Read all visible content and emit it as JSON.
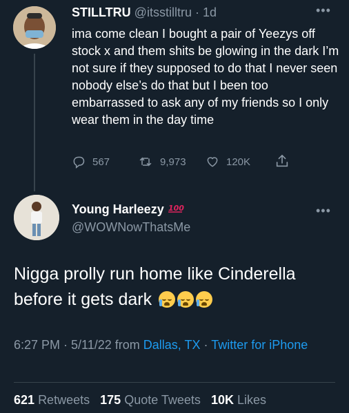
{
  "tweet1": {
    "display_name": "STILLTRU",
    "handle_time": "@itsstilltru · 1d",
    "text": "ima come clean I bought a pair of Yeezys off stock x and them shits be glowing in the dark I’m not sure if they supposed to do that I never seen nobody else’s do that but I been too embarrassed to ask any of my friends so I only wear them in the day time",
    "replies": "567",
    "retweets": "9,973",
    "likes": "120K"
  },
  "tweet2": {
    "display_name": "Young Harleezy",
    "handle": "@WOWNowThatsMe",
    "text": "Nigga prolly run home like Cinderella before it gets dark",
    "time_date": "6:27 PM · 5/11/22",
    "from_word": "from",
    "location": "Dallas, TX",
    "source_sep": "·",
    "source": "Twitter for iPhone",
    "retweets_count": "621",
    "retweets_label": "Retweets",
    "quotes_count": "175",
    "quotes_label": "Quote Tweets",
    "likes_count": "10K",
    "likes_label": "Likes"
  },
  "icons": {
    "reply": "reply-icon",
    "retweet": "retweet-icon",
    "like": "heart-icon",
    "share": "share-icon",
    "more": "more-icon",
    "hundred": "hundred-emoji",
    "crying": "crying-emoji"
  },
  "colors": {
    "background": "#15202b",
    "muted": "#8b98a5",
    "link": "#1d9bf0",
    "divider": "#38444d"
  }
}
